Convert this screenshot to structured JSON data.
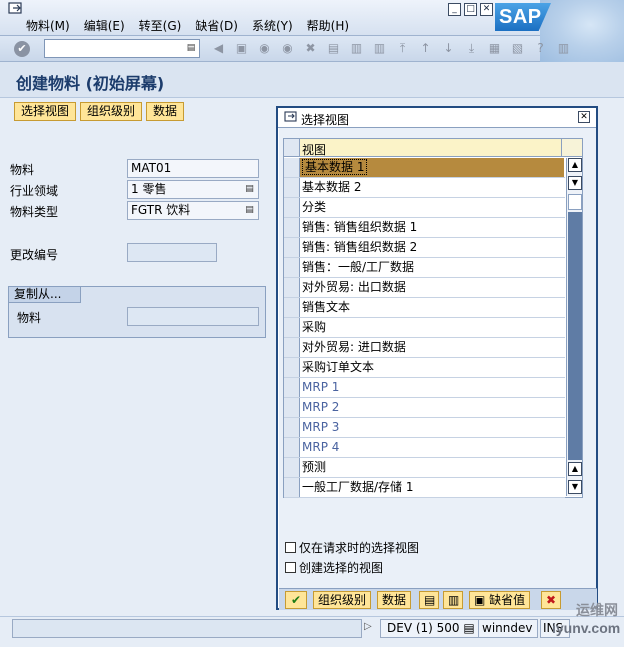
{
  "menubar": {
    "items": [
      "物料(M)",
      "编辑(E)",
      "转至(G)",
      "缺省(D)",
      "系统(Y)",
      "帮助(H)"
    ],
    "logo": "SAP"
  },
  "toolbar": {
    "command_value": ""
  },
  "title": "创建物料 (初始屏幕)",
  "app_toolbar": {
    "select_views": "选择视图",
    "org_levels": "组织级别",
    "data": "数据"
  },
  "form": {
    "material_label": "物料",
    "material_value": "MAT01",
    "industry_label": "行业领域",
    "industry_value": "1 零售",
    "type_label": "物料类型",
    "type_value": "FGTR 饮料",
    "change_no_label": "更改编号",
    "change_no_value": "",
    "copy_from_tab": "复制从...",
    "copy_material_label": "物料",
    "copy_material_value": ""
  },
  "dialog": {
    "title": "选择视图",
    "column_header": "视图",
    "rows": [
      {
        "label": "基本数据 1",
        "selected": true
      },
      {
        "label": "基本数据 2"
      },
      {
        "label": "分类"
      },
      {
        "label": "销售: 销售组织数据 1"
      },
      {
        "label": "销售: 销售组织数据 2"
      },
      {
        "label": "销售：一般/工厂数据"
      },
      {
        "label": "对外贸易: 出口数据"
      },
      {
        "label": "销售文本"
      },
      {
        "label": "采购"
      },
      {
        "label": "对外贸易: 进口数据"
      },
      {
        "label": "采购订单文本"
      },
      {
        "label": "MRP 1",
        "dim": true
      },
      {
        "label": "MRP 2",
        "dim": true
      },
      {
        "label": "MRP 3",
        "dim": true
      },
      {
        "label": "MRP 4",
        "dim": true
      },
      {
        "label": "预测"
      },
      {
        "label": "一般工厂数据/存储 1"
      }
    ],
    "option_1": "仅在请求时的选择视图",
    "option_2": "创建选择的视图",
    "footer": {
      "org_levels": "组织级别",
      "data": "数据",
      "defaults": "缺省值"
    }
  },
  "status": {
    "system": "DEV (1) 500",
    "host": "winndev",
    "mode": "INS"
  },
  "watermark": {
    "line1": "运维网",
    "line2": "iyunv.com"
  }
}
